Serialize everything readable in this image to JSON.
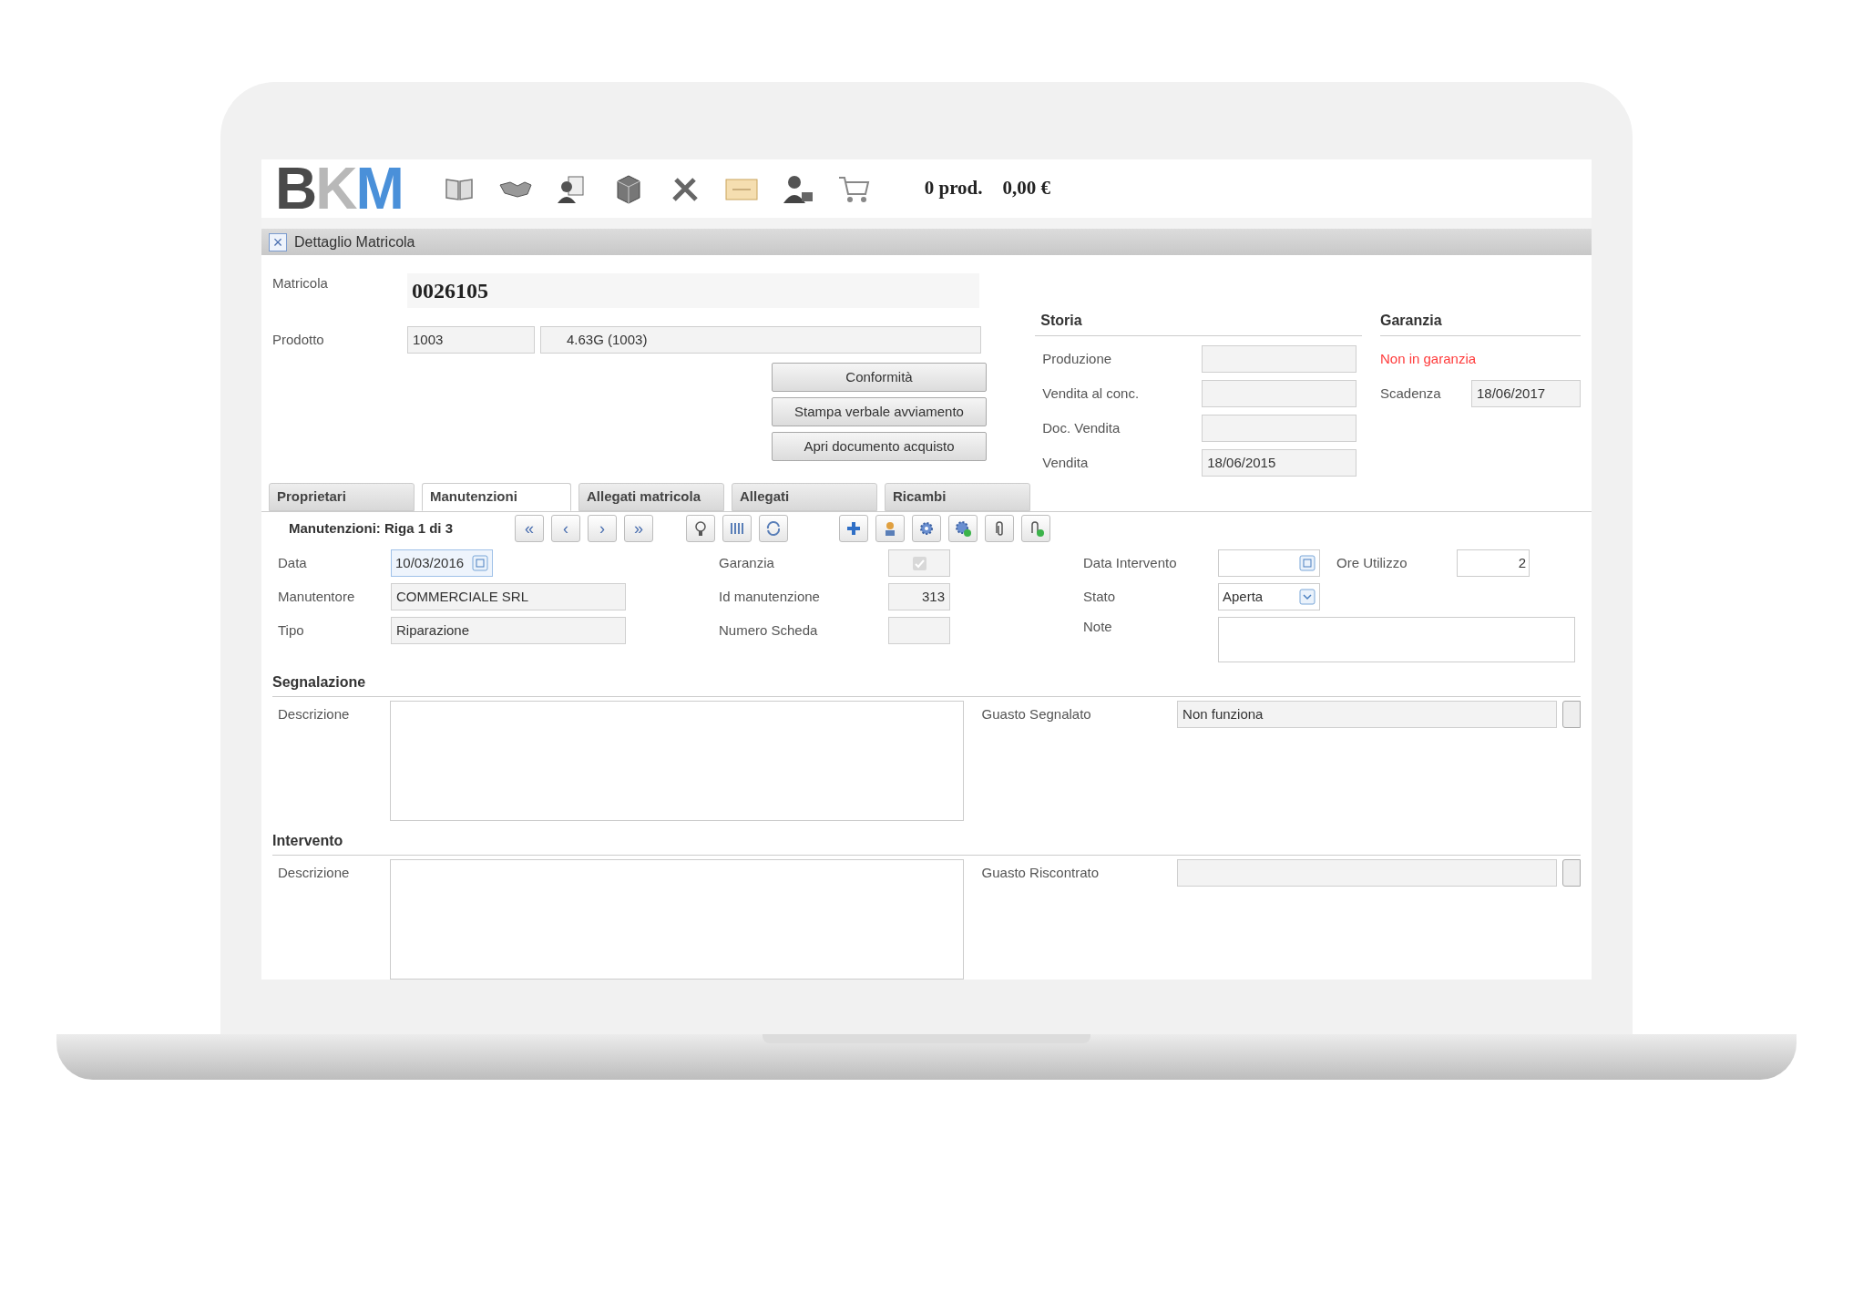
{
  "header": {
    "logo": [
      {
        "text": "B",
        "color": "#4a4a4a"
      },
      {
        "text": "K",
        "color": "#b8b8b8"
      },
      {
        "text": "M",
        "color": "#4a90d9"
      }
    ],
    "cart_count": "0 prod.",
    "cart_total": "0,00 €"
  },
  "panel": {
    "title": "Dettaglio Matricola",
    "close": "×"
  },
  "matricola": {
    "label": "Matricola",
    "value": "0026105"
  },
  "prodotto": {
    "label": "Prodotto",
    "code": "1003",
    "name": "4.63G (1003)"
  },
  "buttons": [
    "Conformità",
    "Stampa verbale avviamento",
    "Apri documento acquisto"
  ],
  "storia": {
    "title": "Storia",
    "rows": [
      {
        "label": "Produzione"
      },
      {
        "label": "Vendita al conc."
      },
      {
        "label": "Doc. Vendita"
      },
      {
        "label": "Vendita",
        "value": "18/06/2015"
      }
    ]
  },
  "garanzia": {
    "title": "Garanzia",
    "status": "Non in garanzia",
    "scadenza_label": "Scadenza",
    "scadenza": "18/06/2017"
  },
  "tabs": [
    {
      "label": "Proprietari",
      "selected": false
    },
    {
      "label": "Manutenzioni",
      "selected": true
    },
    {
      "label": "Allegati matricola",
      "selected": false
    },
    {
      "label": "Allegati",
      "selected": false
    },
    {
      "label": "Ricambi",
      "selected": false
    }
  ],
  "record_toolbar": {
    "label": "Manutenzioni: Riga 1 di 3",
    "nav": [
      "«",
      "‹",
      "›",
      "»"
    ]
  },
  "manutenzione": {
    "data_label": "Data",
    "data": "10/03/2016",
    "manutentore_label": "Manutentore",
    "manutentore": "COMMERCIALE SRL",
    "tipo_label": "Tipo",
    "tipo": "Riparazione",
    "garanzia_label": "Garanzia",
    "garanzia_checked": true,
    "garanzia_disabled": true,
    "id_label": "Id manutenzione",
    "id": "313",
    "scheda_label": "Numero Scheda",
    "data_intervento_label": "Data Intervento",
    "stato_label": "Stato",
    "stato": "Aperta",
    "note_label": "Note",
    "ore_label": "Ore Utilizzo",
    "ore": "2"
  },
  "segnalazione": {
    "title": "Segnalazione",
    "descrizione_label": "Descrizione",
    "guasto_label": "Guasto Segnalato",
    "guasto": "Non funziona"
  },
  "intervento": {
    "title": "Intervento",
    "descrizione_label": "Descrizione",
    "guasto_label": "Guasto Riscontrato"
  }
}
